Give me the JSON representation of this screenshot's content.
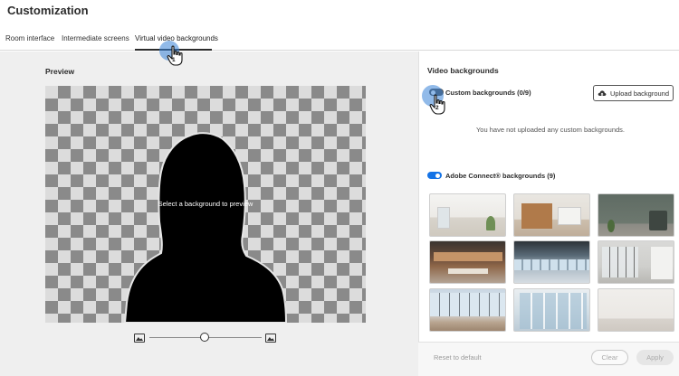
{
  "header": {
    "title": "Customization"
  },
  "tabs": [
    {
      "label": "Room interface"
    },
    {
      "label": "Intermediate screens"
    },
    {
      "label": "Virtual video backgrounds"
    }
  ],
  "preview": {
    "label": "Preview",
    "placeholder": "Select a background to preview"
  },
  "video_backgrounds": {
    "title": "Video backgrounds",
    "custom_label": "Custom backgrounds (0/9)",
    "upload_label": "Upload background",
    "empty_message": "You have not uploaded any custom backgrounds.",
    "adobe_label": "Adobe Connect® backgrounds (9)",
    "thumbnails": [
      {
        "name": "bright living room"
      },
      {
        "name": "wood panel office"
      },
      {
        "name": "green wall room"
      },
      {
        "name": "brick loft office"
      },
      {
        "name": "open plan office"
      },
      {
        "name": "glass meeting room"
      },
      {
        "name": "glass corner office"
      },
      {
        "name": "glass hallway"
      },
      {
        "name": "empty white room"
      }
    ]
  },
  "footer": {
    "reset_label": "Reset to default",
    "clear_label": "Clear",
    "apply_label": "Apply"
  },
  "cursor_markers": {
    "tab_step": "1",
    "toggle_step": "2"
  },
  "colors": {
    "accent": "#1473e6",
    "highlight": "#3782d7"
  }
}
